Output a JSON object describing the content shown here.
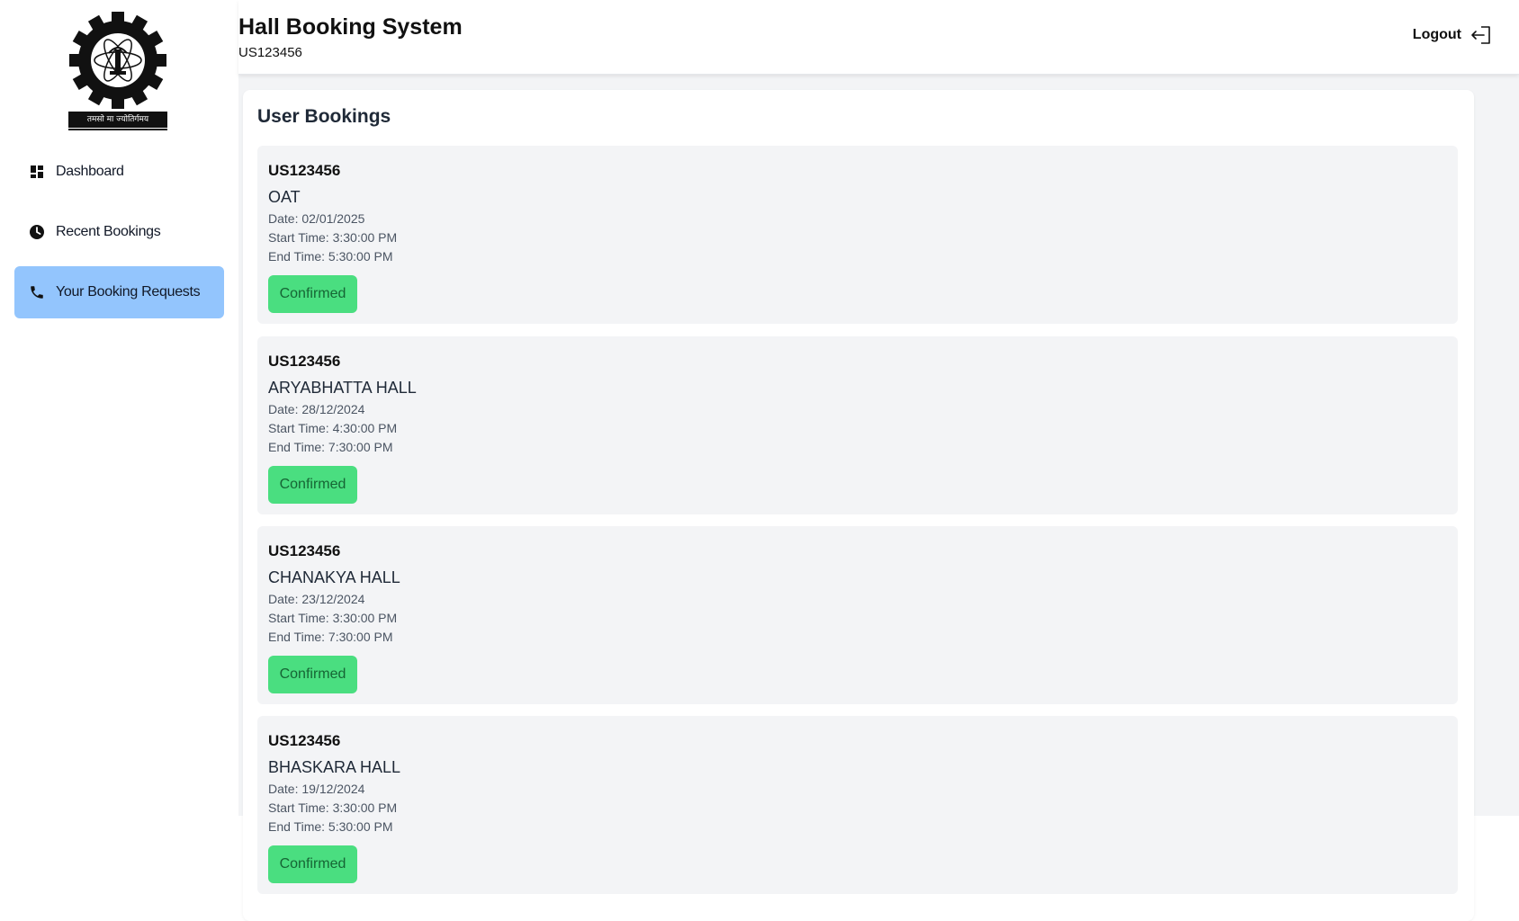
{
  "app": {
    "title": "Hall Booking System",
    "user_id": "US123456",
    "logout_label": "Logout"
  },
  "logo": {
    "banner_text": "तमसो मा ज्योतिर्गमय"
  },
  "sidebar": {
    "items": [
      {
        "label": "Dashboard",
        "icon": "dashboard-grid-icon",
        "active": false
      },
      {
        "label": "Recent Bookings",
        "icon": "clock-icon",
        "active": false
      },
      {
        "label": "Your Booking Requests",
        "icon": "phone-icon",
        "active": true
      }
    ]
  },
  "main": {
    "section_title": "User Bookings",
    "bookings": [
      {
        "user": "US123456",
        "hall": "OAT",
        "date": "Date: 02/01/2025",
        "start": "Start Time: 3:30:00 PM",
        "end": "End Time: 5:30:00 PM",
        "status": "Confirmed"
      },
      {
        "user": "US123456",
        "hall": "ARYABHATTA HALL",
        "date": "Date: 28/12/2024",
        "start": "Start Time: 4:30:00 PM",
        "end": "End Time: 7:30:00 PM",
        "status": "Confirmed"
      },
      {
        "user": "US123456",
        "hall": "CHANAKYA HALL",
        "date": "Date: 23/12/2024",
        "start": "Start Time: 3:30:00 PM",
        "end": "End Time: 7:30:00 PM",
        "status": "Confirmed"
      },
      {
        "user": "US123456",
        "hall": "BHASKARA HALL",
        "date": "Date: 19/12/2024",
        "start": "Start Time: 3:30:00 PM",
        "end": "End Time: 5:30:00 PM",
        "status": "Confirmed"
      }
    ]
  },
  "colors": {
    "active_nav": "#93c5fd",
    "confirmed_badge": "#4ade80",
    "confirmed_text": "#166534",
    "page_bg": "#f3f4f6"
  }
}
